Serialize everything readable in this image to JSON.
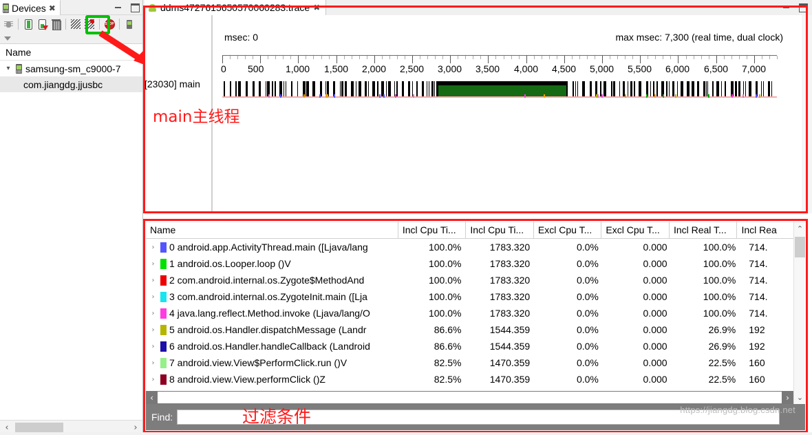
{
  "devices_view": {
    "tab_label": "Devices",
    "tab_close": "✖",
    "icons": {
      "device": "device-phone-icon",
      "close": "close-icon",
      "minimize": "minimize-icon",
      "maximize": "maximize-icon",
      "debug": "debug-bug-icon",
      "heap_update": "update-heap-icon",
      "heap_dump": "dump-hprof-icon",
      "gc": "cause-gc-trash-icon",
      "threads_update": "update-threads-icon",
      "method_profiling": "start-method-profiling-icon",
      "stop": "stop-process-icon",
      "screen_capture": "screen-capture-icon",
      "filter": "view-menu-icon"
    },
    "name_header": "Name",
    "tree": [
      {
        "label": "samsung-sm_c9000-7",
        "expanded": true
      },
      {
        "label": "com.jiangdg.jjusbc",
        "selected": true
      }
    ]
  },
  "trace_editor": {
    "tab_label": "ddms4727615650570060283.trace",
    "tab_close": "✖",
    "msec_start": "msec: 0",
    "msec_max": "max msec: 7,300 (real time, dual clock)",
    "thread_label": "[23030] main",
    "ruler_labels": [
      "0",
      "500",
      "1,000",
      "1,500",
      "2,000",
      "2,500",
      "3,000",
      "3,500",
      "4,000",
      "4,500",
      "5,000",
      "5,500",
      "6,000",
      "6,500",
      "7,000"
    ],
    "ruler_values": [
      0,
      500,
      1000,
      1500,
      2000,
      2500,
      3000,
      3500,
      4000,
      4500,
      5000,
      5500,
      6000,
      6500,
      7000
    ],
    "ruler_max": 7300
  },
  "annotations": {
    "main_thread": "main主线程",
    "filter": "过滤条件",
    "box_color": "#ff1a1a",
    "highlight_color": "#00c000"
  },
  "profile_table": {
    "columns": [
      {
        "label": "Name",
        "kind": "name"
      },
      {
        "label": "Incl Cpu Ti...",
        "kind": "num"
      },
      {
        "label": "Incl Cpu Ti...",
        "kind": "num"
      },
      {
        "label": "Excl Cpu T...",
        "kind": "num"
      },
      {
        "label": "Excl Cpu T...",
        "kind": "num"
      },
      {
        "label": "Incl Real T...",
        "kind": "num"
      },
      {
        "label": "Incl Rea",
        "kind": "num"
      }
    ],
    "rows": [
      {
        "twisty": "›",
        "color": "#5555ff",
        "name": "0 android.app.ActivityThread.main ([Ljava/lang",
        "incl_cpu_pct": "100.0%",
        "incl_cpu_time": "1783.320",
        "excl_cpu_pct": "0.0%",
        "excl_cpu_time": "0.000",
        "incl_real_pct": "100.0%",
        "incl_real_time": "714."
      },
      {
        "twisty": "›",
        "color": "#00e000",
        "name": "1 android.os.Looper.loop ()V",
        "incl_cpu_pct": "100.0%",
        "incl_cpu_time": "1783.320",
        "excl_cpu_pct": "0.0%",
        "excl_cpu_time": "0.000",
        "incl_real_pct": "100.0%",
        "incl_real_time": "714."
      },
      {
        "twisty": "›",
        "color": "#ee0000",
        "name": "2 com.android.internal.os.Zygote$MethodAnd",
        "incl_cpu_pct": "100.0%",
        "incl_cpu_time": "1783.320",
        "excl_cpu_pct": "0.0%",
        "excl_cpu_time": "0.000",
        "incl_real_pct": "100.0%",
        "incl_real_time": "714."
      },
      {
        "twisty": "›",
        "color": "#17e5ef",
        "name": "3 com.android.internal.os.ZygoteInit.main ([Lja",
        "incl_cpu_pct": "100.0%",
        "incl_cpu_time": "1783.320",
        "excl_cpu_pct": "0.0%",
        "excl_cpu_time": "0.000",
        "incl_real_pct": "100.0%",
        "incl_real_time": "714."
      },
      {
        "twisty": "›",
        "color": "#ff3ce0",
        "name": "4 java.lang.reflect.Method.invoke (Ljava/lang/O",
        "incl_cpu_pct": "100.0%",
        "incl_cpu_time": "1783.320",
        "excl_cpu_pct": "0.0%",
        "excl_cpu_time": "0.000",
        "incl_real_pct": "100.0%",
        "incl_real_time": "714."
      },
      {
        "twisty": "›",
        "color": "#b5b500",
        "name": "5 android.os.Handler.dispatchMessage (Landr",
        "incl_cpu_pct": "86.6%",
        "incl_cpu_time": "1544.359",
        "excl_cpu_pct": "0.0%",
        "excl_cpu_time": "0.000",
        "incl_real_pct": "26.9%",
        "incl_real_time": "192"
      },
      {
        "twisty": "›",
        "color": "#1b10a8",
        "name": "6 android.os.Handler.handleCallback (Landroid",
        "incl_cpu_pct": "86.6%",
        "incl_cpu_time": "1544.359",
        "excl_cpu_pct": "0.0%",
        "excl_cpu_time": "0.000",
        "incl_real_pct": "26.9%",
        "incl_real_time": "192"
      },
      {
        "twisty": "›",
        "color": "#96f08a",
        "name": "7 android.view.View$PerformClick.run ()V",
        "incl_cpu_pct": "82.5%",
        "incl_cpu_time": "1470.359",
        "excl_cpu_pct": "0.0%",
        "excl_cpu_time": "0.000",
        "incl_real_pct": "22.5%",
        "incl_real_time": "160"
      },
      {
        "twisty": "›",
        "color": "#8d0020",
        "name": "8 android.view.View.performClick ()Z",
        "incl_cpu_pct": "82.5%",
        "incl_cpu_time": "1470.359",
        "excl_cpu_pct": "0.0%",
        "excl_cpu_time": "0.000",
        "incl_real_pct": "22.5%",
        "incl_real_time": "160"
      }
    ],
    "find_label": "Find:",
    "find_value": "",
    "find_placeholder": "",
    "scroll_left_arrow": "‹",
    "scroll_right_arrow": "›",
    "scroll_up_arrow": "⌃",
    "scroll_down_arrow": "⌄"
  },
  "watermark": "https://jiangdg.blog.csdn.net"
}
